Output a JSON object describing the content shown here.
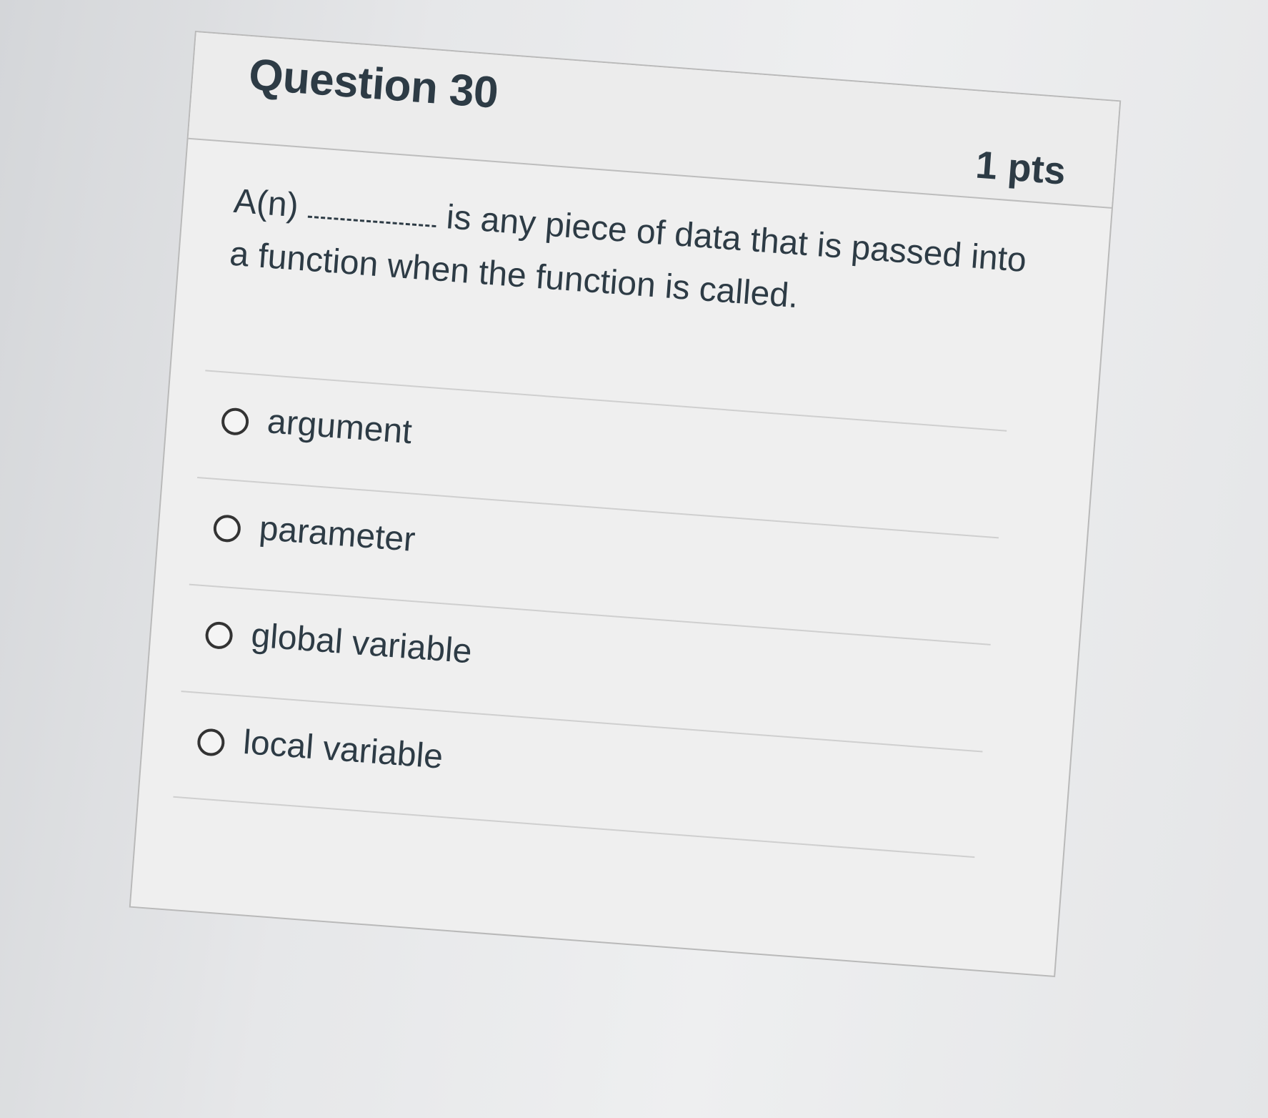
{
  "question": {
    "title": "Question 30",
    "points": "1 pts",
    "text_prefix": "A(n)",
    "text_suffix": "is any piece of data that is passed into a function when the function is called."
  },
  "answers": [
    {
      "label": "argument",
      "selected": false
    },
    {
      "label": "parameter",
      "selected": false
    },
    {
      "label": "global variable",
      "selected": false
    },
    {
      "label": "local variable",
      "selected": false
    }
  ]
}
